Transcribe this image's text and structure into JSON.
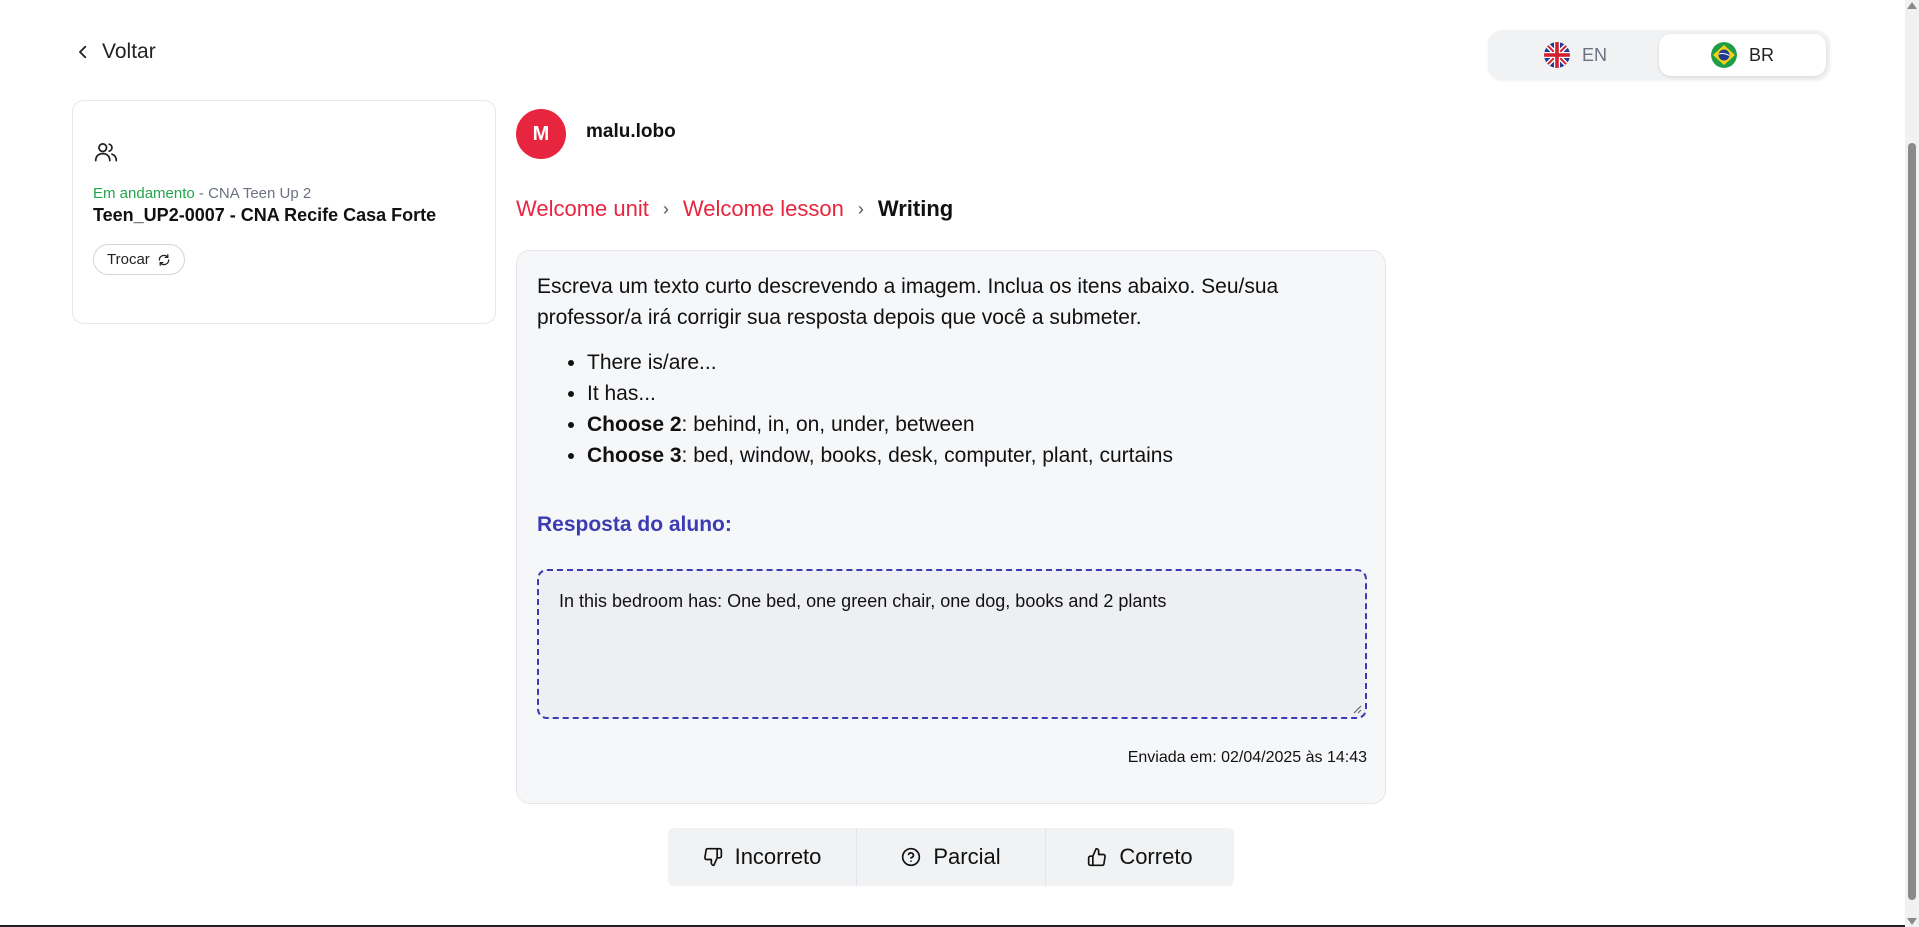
{
  "nav": {
    "back_label": "Voltar"
  },
  "language": {
    "options": [
      {
        "code": "EN",
        "flag": "uk-flag-icon",
        "active": false
      },
      {
        "code": "BR",
        "flag": "brazil-flag-icon",
        "active": true
      }
    ]
  },
  "class_card": {
    "status": "Em andamento",
    "separator": " - ",
    "course": "CNA Teen Up 2",
    "class_name": "Teen_UP2-0007 - CNA Recife Casa Forte",
    "switch_label": "Trocar"
  },
  "student": {
    "initial": "M",
    "username": "malu.lobo"
  },
  "breadcrumb": {
    "unit": "Welcome unit",
    "lesson": "Welcome lesson",
    "current": "Writing"
  },
  "exercise": {
    "instructions": "Escreva um texto curto descrevendo a imagem. Inclua os itens abaixo. Seu/sua professor/a irá corrigir sua resposta depois que você a submeter.",
    "items": [
      {
        "bold": "",
        "text": "There is/are..."
      },
      {
        "bold": "",
        "text": "It has..."
      },
      {
        "bold": "Choose 2",
        "text": ": behind, in, on, under, between"
      },
      {
        "bold": "Choose 3",
        "text": ": bed, window, books, desk, computer, plant, curtains"
      }
    ],
    "answer_label": "Resposta do aluno:",
    "answer_text": "In this bedroom has: One bed, one green chair, one dog, books and 2 plants",
    "sent_at": "Enviada em: 02/04/2025 às 14:43"
  },
  "grading": {
    "incorrect_label": "Incorreto",
    "partial_label": "Parcial",
    "correct_label": "Correto"
  },
  "colors": {
    "accent_red": "#e8253f",
    "answer_blue": "#3b3bb3",
    "status_green": "#22a54a"
  }
}
